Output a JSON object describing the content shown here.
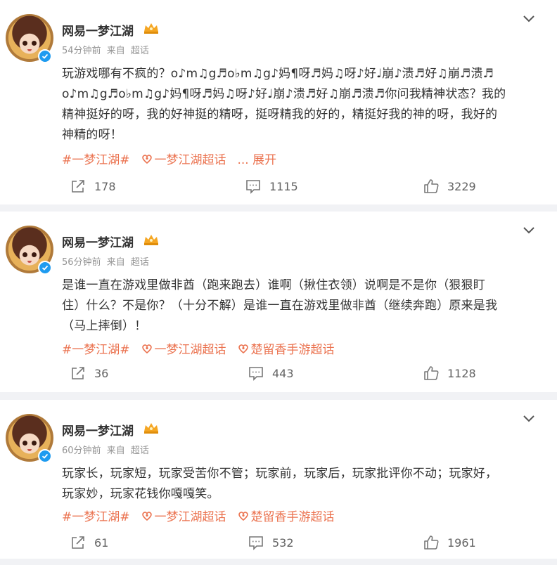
{
  "posts": [
    {
      "author": "网易一梦江湖",
      "time": "54分钟前",
      "from_label": "来自",
      "source": "超话",
      "text_lines": [
        "玩游戏哪有不疯的？o♪m♫g♬o♭m♫g♪妈¶呀♬妈♫呀♪好♩崩♪溃♬好♫崩♬溃♬",
        "o♪m♫g♬o♭m♫g♪妈¶呀♬妈♫呀♪好♩崩♪溃♬好♫崩♬溃♬你问我精神状态？我的",
        "精神挺好的呀，我的好神挺的精呀，挺呀精我的好的，精挺好我的神的呀，我好的",
        "神精的呀！"
      ],
      "tags": [
        "#一梦江湖#",
        "一梦江湖超话"
      ],
      "more_label": "... 展开",
      "reposts": "178",
      "comments": "1115",
      "likes": "3229"
    },
    {
      "author": "网易一梦江湖",
      "time": "56分钟前",
      "from_label": "来自",
      "source": "超话",
      "text_lines": [
        "是谁一直在游戏里做非酋（跑来跑去）谁啊（揪住衣领）说啊是不是你（狠狠盯",
        "住）什么？不是你？（十分不解）是谁一直在游戏里做非酋（继续奔跑）原来是我",
        "（马上摔倒）！"
      ],
      "tags": [
        "#一梦江湖#",
        "一梦江湖超话",
        "楚留香手游超话"
      ],
      "reposts": "36",
      "comments": "443",
      "likes": "1128"
    },
    {
      "author": "网易一梦江湖",
      "time": "60分钟前",
      "from_label": "来自",
      "source": "超话",
      "text_lines": [
        "玩家长，玩家短，玩家受苦你不管；玩家前，玩家后，玩家批评你不动；玩家好，",
        "玩家妙，玩家花钱你嘎嘎笑。"
      ],
      "tags": [
        "#一梦江湖#",
        "一梦江湖超话",
        "楚留香手游超话"
      ],
      "reposts": "61",
      "comments": "532",
      "likes": "1961"
    }
  ],
  "colors": {
    "accent": "#eb7350",
    "verified": "#1e9bf0",
    "meta": "#939393"
  },
  "icons": {
    "repost": "repost-icon",
    "comment": "comment-icon",
    "like": "like-icon",
    "more": "chevron-down-icon"
  }
}
